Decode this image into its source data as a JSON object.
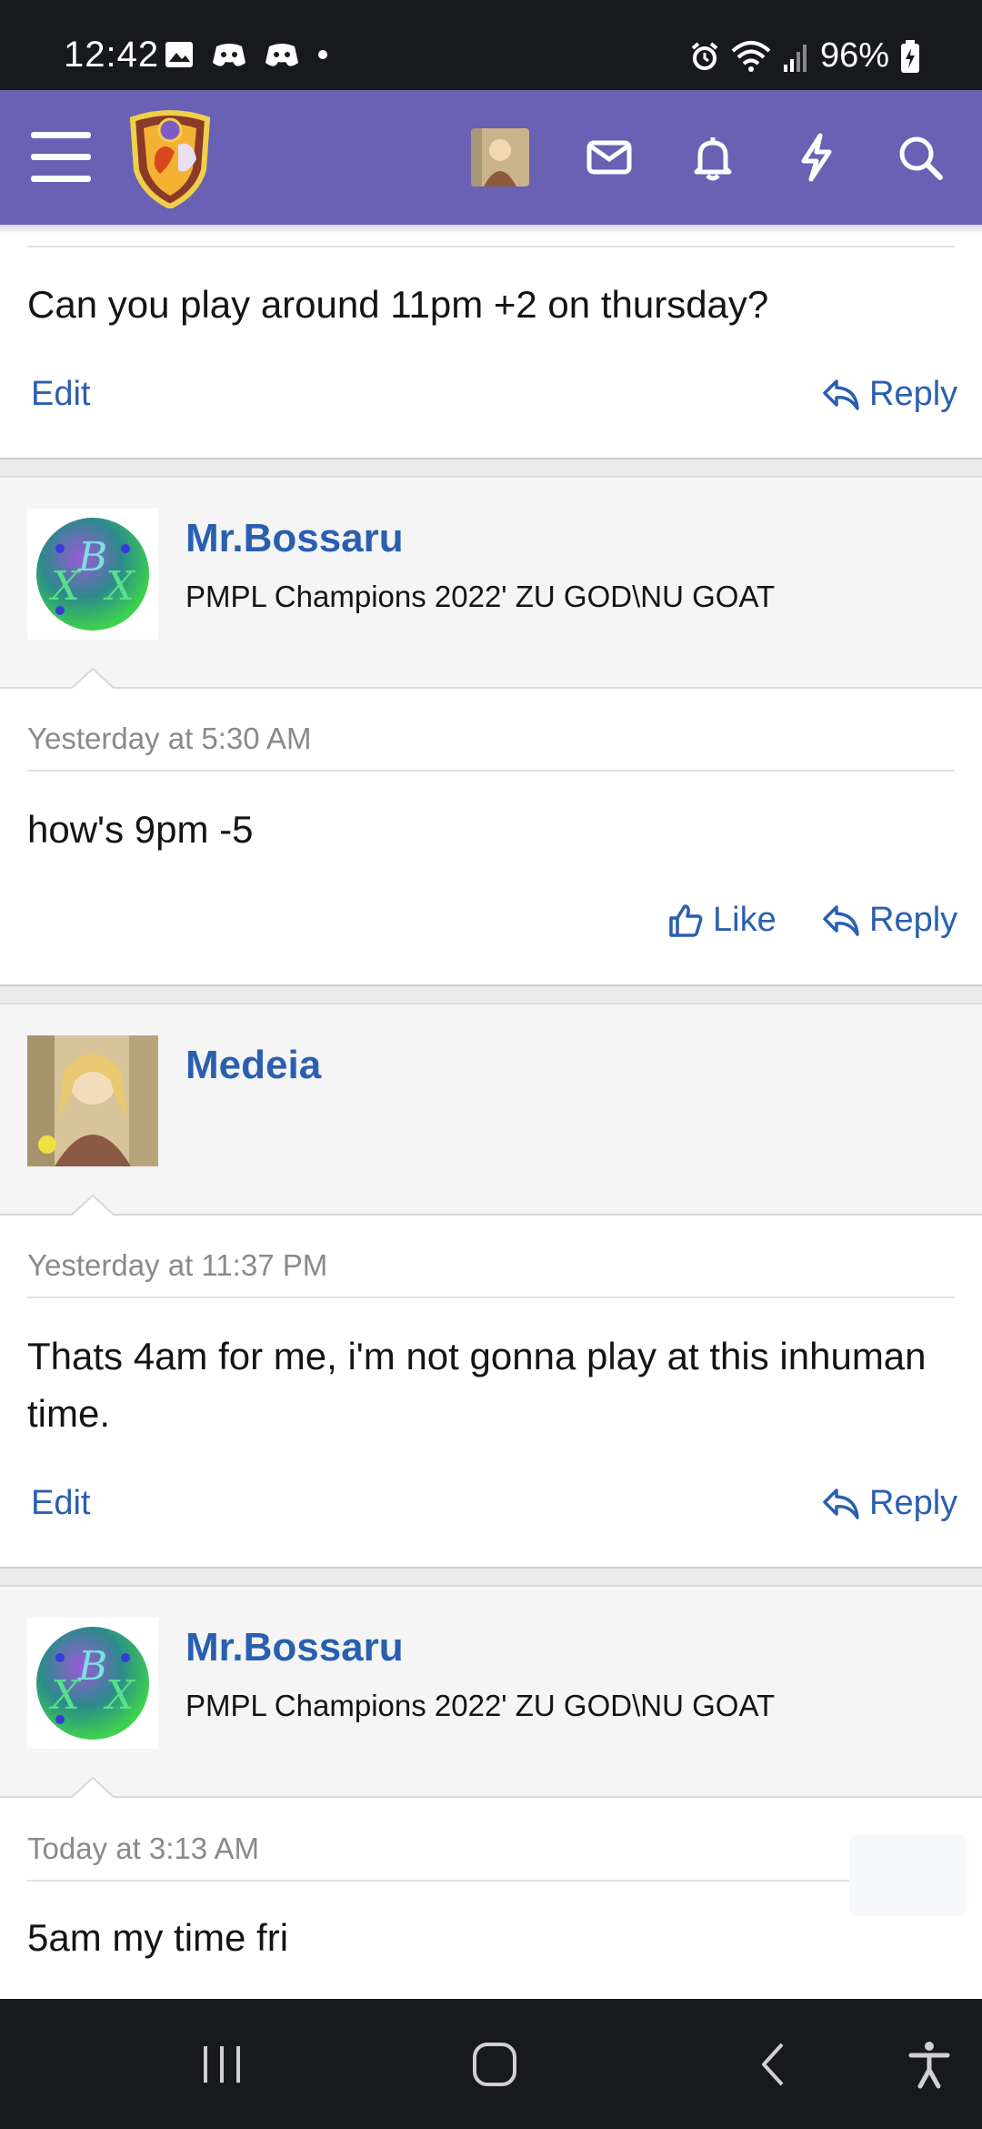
{
  "status_bar": {
    "time": "12:42",
    "battery": "96%"
  },
  "nav": {
    "menu_icon": "hamburger-icon",
    "icons": [
      "inbox-icon",
      "bell-icon",
      "bolt-icon",
      "search-icon"
    ]
  },
  "colors": {
    "nav_bg": "#6a60b4",
    "link": "#2a5fb0",
    "status_bg": "#17191c"
  },
  "posts": [
    {
      "body": "Can you play around 11pm +2 on thursday?",
      "actions": {
        "edit": "Edit",
        "reply": "Reply"
      }
    },
    {
      "user": "Mr.Bossaru",
      "user_title": "PMPL Champions 2022' ZU GOD\\NU GOAT",
      "timestamp": "Yesterday at 5:30 AM",
      "body": "how's 9pm -5",
      "actions": {
        "like": "Like",
        "reply": "Reply"
      }
    },
    {
      "user": "Medeia",
      "timestamp": "Yesterday at 11:37 PM",
      "body": "Thats 4am for me, i'm not gonna play at this inhuman time.",
      "actions": {
        "edit": "Edit",
        "reply": "Reply"
      }
    },
    {
      "user": "Mr.Bossaru",
      "user_title": "PMPL Champions 2022' ZU GOD\\NU GOAT",
      "timestamp": "Today at 3:13 AM",
      "body": "5am my time fri"
    }
  ],
  "bottom_nav": {
    "icons": [
      "recent-apps-icon",
      "home-icon",
      "back-icon",
      "accessibility-icon"
    ]
  }
}
